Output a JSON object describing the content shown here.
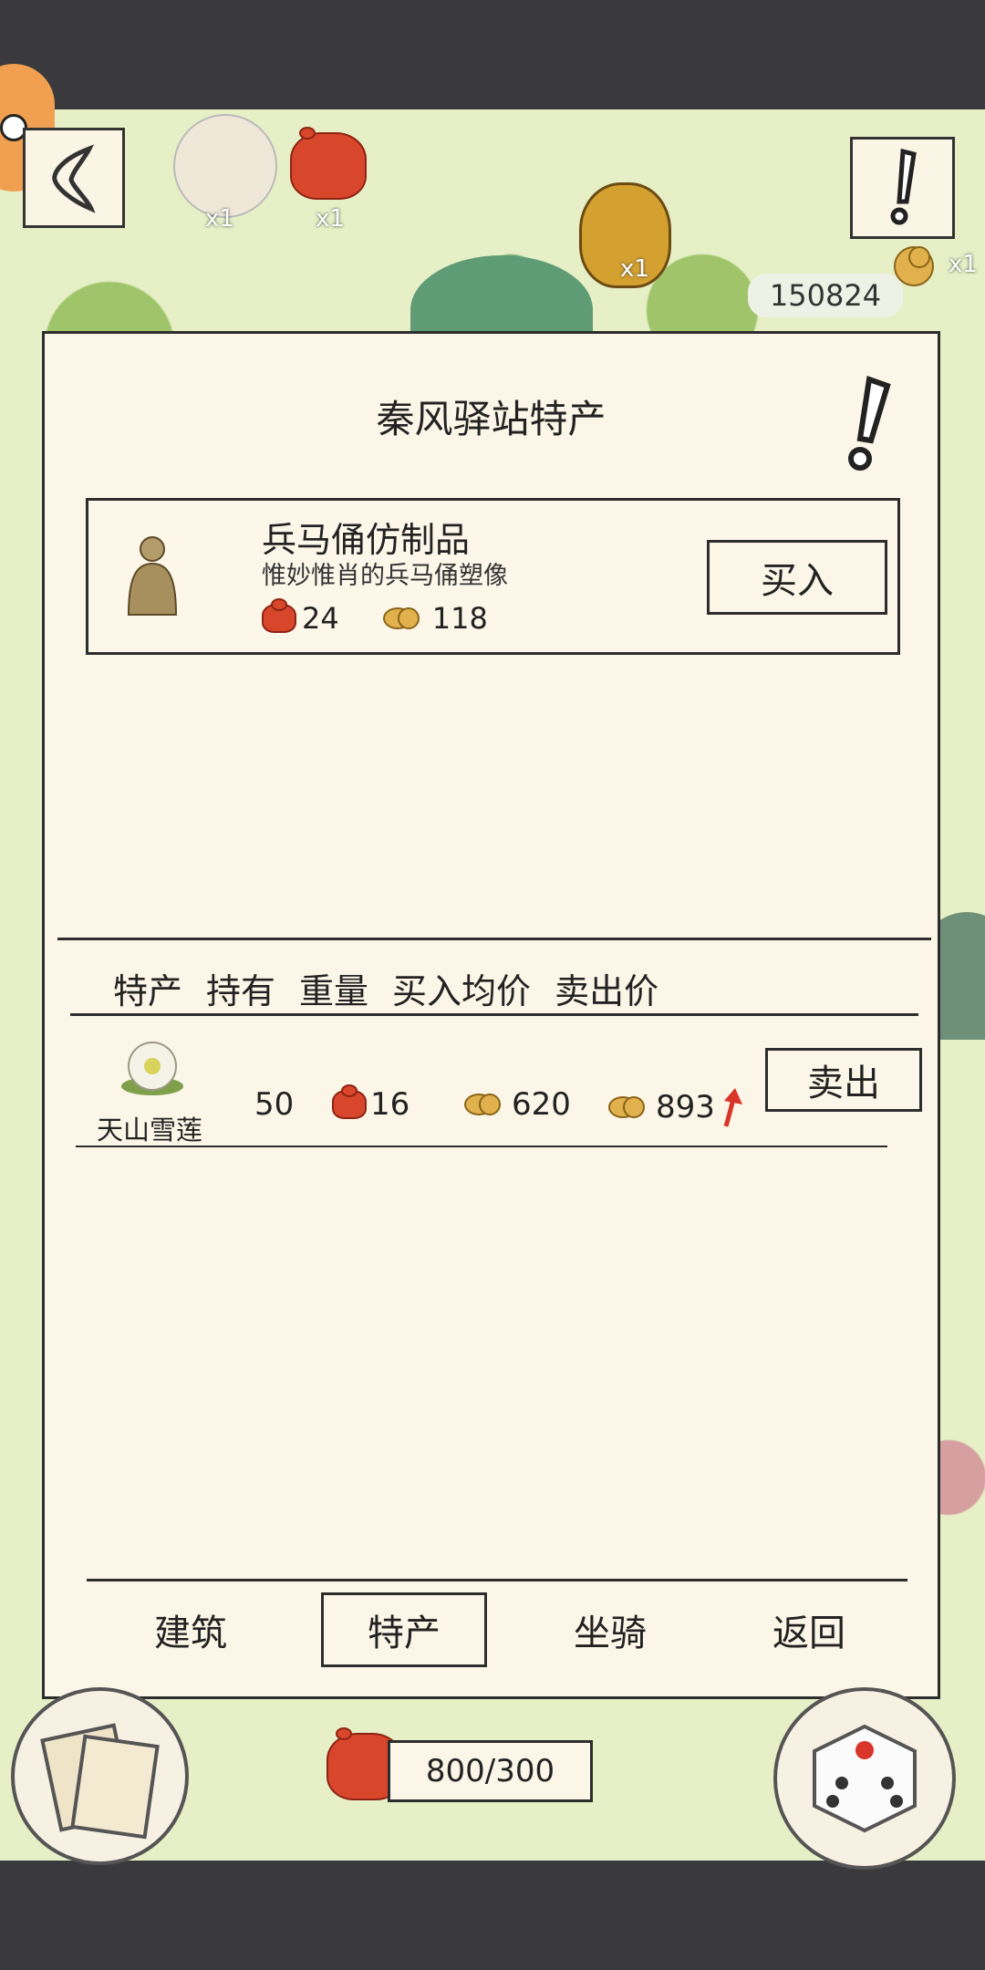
{
  "hud": {
    "top_items": [
      {
        "name": "lion-mount",
        "count": "x1"
      },
      {
        "name": "bundle",
        "count": "x1"
      },
      {
        "name": "wine-jar",
        "count": "x1"
      },
      {
        "name": "coin-stack",
        "count": "x1"
      }
    ],
    "coins": "150824",
    "capacity": "800/300"
  },
  "dialog": {
    "title": "秦风驿站特产",
    "shop_item": {
      "name": "兵马俑仿制品",
      "desc": "惟妙惟肖的兵马俑塑像",
      "weight": "24",
      "price": "118",
      "buy_label": "买入"
    },
    "table": {
      "headers": [
        "特产",
        "持有",
        "重量",
        "买入均价",
        "卖出价"
      ],
      "rows": [
        {
          "name": "天山雪莲",
          "held": "50",
          "weight": "16",
          "avg_buy": "620",
          "sell_price": "893",
          "sell_label": "卖出"
        }
      ]
    },
    "tabs": [
      {
        "label": "建筑",
        "active": false
      },
      {
        "label": "特产",
        "active": true
      },
      {
        "label": "坐骑",
        "active": false
      },
      {
        "label": "返回",
        "active": false
      }
    ]
  },
  "colors": {
    "panel_bg": "#fcf6e8",
    "map_bg": "#e6efc6",
    "price_up_arrow": "#d9352a"
  },
  "icons": [
    "back-arrow-icon",
    "exclamation-icon",
    "bundle-icon",
    "coin-icon",
    "up-arrow-icon",
    "dice-icon",
    "cards-icon"
  ]
}
